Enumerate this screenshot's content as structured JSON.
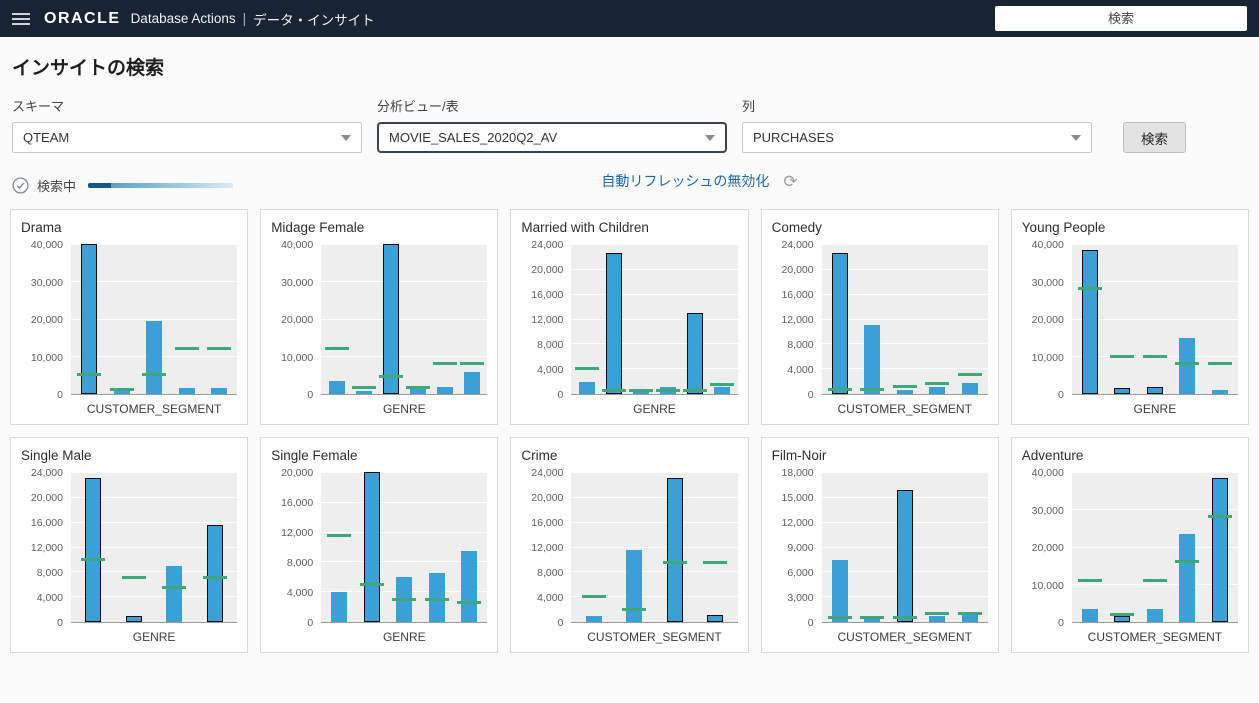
{
  "header": {
    "brand": "ORACLE",
    "app": "Database Actions",
    "separator": "|",
    "page": "データ・インサイト",
    "search_placeholder": "検索"
  },
  "main": {
    "title": "インサイトの検索",
    "form": {
      "schema_label": "スキーマ",
      "schema_value": "QTEAM",
      "av_label": "分析ビュー/表",
      "av_value": "MOVIE_SALES_2020Q2_AV",
      "column_label": "列",
      "column_value": "PURCHASES",
      "search_button": "検索"
    },
    "status": {
      "searching_label": "検索中",
      "auto_refresh_link": "自動リフレッシュの無効化"
    }
  },
  "colors": {
    "header_bg": "#182433",
    "bar": "#3aa0d6",
    "marker": "#3fa77c",
    "link": "#1a66b3",
    "progress_dark": "#17578e"
  },
  "chart_data": [
    {
      "type": "bar",
      "title": "Drama",
      "xlabel": "CUSTOMER_SEGMENT",
      "ymax": 40000,
      "yticks": [
        0,
        10000,
        20000,
        30000,
        40000
      ],
      "values": [
        40000,
        1200,
        19500,
        1500,
        1500
      ],
      "outlined": [
        true,
        false,
        false,
        false,
        false
      ],
      "markers": [
        5000,
        1000,
        5000,
        12000,
        12000
      ]
    },
    {
      "type": "bar",
      "title": "Midage Female",
      "xlabel": "GENRE",
      "ymax": 40000,
      "yticks": [
        0,
        10000,
        20000,
        30000,
        40000
      ],
      "values": [
        3500,
        900,
        40000,
        1300,
        1800,
        6000
      ],
      "outlined": [
        false,
        false,
        true,
        false,
        false,
        false
      ],
      "markers": [
        12000,
        1500,
        4500,
        1500,
        8000,
        8000
      ]
    },
    {
      "type": "bar",
      "title": "Married with Children",
      "xlabel": "GENRE",
      "ymax": 24000,
      "yticks": [
        0,
        4000,
        8000,
        12000,
        16000,
        20000,
        24000
      ],
      "values": [
        2000,
        22500,
        600,
        1100,
        13000,
        1200
      ],
      "outlined": [
        false,
        true,
        false,
        false,
        true,
        false
      ],
      "markers": [
        4000,
        500,
        500,
        500,
        500,
        1500
      ]
    },
    {
      "type": "bar",
      "title": "Comedy",
      "xlabel": "CUSTOMER_SEGMENT",
      "ymax": 24000,
      "yticks": [
        0,
        4000,
        8000,
        12000,
        16000,
        20000,
        24000
      ],
      "values": [
        22500,
        11000,
        700,
        1200,
        1800
      ],
      "outlined": [
        true,
        false,
        false,
        false,
        false
      ],
      "markers": [
        600,
        600,
        1200,
        1600,
        3000
      ]
    },
    {
      "type": "bar",
      "title": "Young People",
      "xlabel": "GENRE",
      "ymax": 40000,
      "yticks": [
        0,
        10000,
        20000,
        30000,
        40000
      ],
      "values": [
        38500,
        1500,
        2000,
        15000,
        1200
      ],
      "outlined": [
        true,
        true,
        true,
        false,
        false
      ],
      "markers": [
        28000,
        10000,
        10000,
        8000,
        8000
      ]
    },
    {
      "type": "bar",
      "title": "Single Male",
      "xlabel": "GENRE",
      "ymax": 24000,
      "yticks": [
        0,
        4000,
        8000,
        12000,
        16000,
        20000,
        24000
      ],
      "values": [
        23000,
        1000,
        9000,
        15500
      ],
      "outlined": [
        true,
        true,
        false,
        true
      ],
      "markers": [
        10000,
        7000,
        5500,
        7000
      ]
    },
    {
      "type": "bar",
      "title": "Single Female",
      "xlabel": "GENRE",
      "ymax": 20000,
      "yticks": [
        0,
        4000,
        8000,
        12000,
        16000,
        20000
      ],
      "values": [
        4000,
        20000,
        6000,
        6500,
        9500
      ],
      "outlined": [
        false,
        true,
        false,
        false,
        false
      ],
      "markers": [
        11500,
        5000,
        3000,
        3000,
        2500
      ]
    },
    {
      "type": "bar",
      "title": "Crime",
      "xlabel": "CUSTOMER_SEGMENT",
      "ymax": 24000,
      "yticks": [
        0,
        4000,
        8000,
        12000,
        16000,
        20000,
        24000
      ],
      "values": [
        900,
        11500,
        23000,
        1100
      ],
      "outlined": [
        false,
        false,
        true,
        true
      ],
      "markers": [
        4000,
        2000,
        9500,
        9500
      ]
    },
    {
      "type": "bar",
      "title": "Film-Noir",
      "xlabel": "CUSTOMER_SEGMENT",
      "ymax": 18000,
      "yticks": [
        0,
        3000,
        6000,
        9000,
        12000,
        15000,
        18000
      ],
      "values": [
        7500,
        600,
        15800,
        700,
        800
      ],
      "outlined": [
        false,
        false,
        true,
        false,
        false
      ],
      "markers": [
        500,
        500,
        500,
        1000,
        1000
      ]
    },
    {
      "type": "bar",
      "title": "Adventure",
      "xlabel": "CUSTOMER_SEGMENT",
      "ymax": 40000,
      "yticks": [
        0,
        10000,
        20000,
        30000,
        40000
      ],
      "values": [
        3500,
        1600,
        3600,
        23500,
        38500
      ],
      "outlined": [
        false,
        true,
        false,
        false,
        true
      ],
      "markers": [
        11000,
        2000,
        11000,
        16000,
        28000
      ]
    }
  ]
}
